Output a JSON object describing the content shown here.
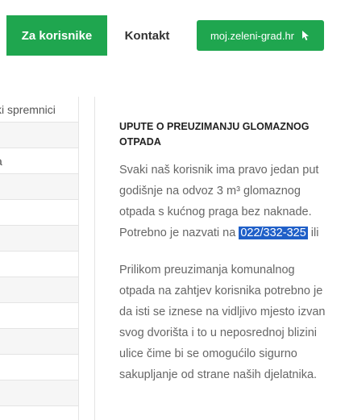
{
  "nav": {
    "active_label": "Za korisnike",
    "contact_label": "Kontakt",
    "portal_label": "moj.zeleni-grad.hr",
    "portal_icon": "cursor-arrow-icon"
  },
  "sidebar": {
    "rows": [
      "ki spremnici",
      "",
      "a",
      "",
      "",
      "",
      "",
      "",
      "",
      "",
      "",
      "",
      ""
    ]
  },
  "article": {
    "title": "UPUTE O PREUZIMANJU GLOMAZNOG OTPADA",
    "para1_text": "Svaki naš korisnik ima pravo jedan put godišnje na odvoz 3 m³ glomaznog otpada s kućnog praga bez naknade. Potrebno je nazvati na ",
    "phone": "022/332-325",
    "para1_tail": " ili",
    "para2": "Prilikom preuzimanja komunalnog otpada na zahtjev korisnika potrebno je da isti se iznese na vidljivo mjesto izvan svog dvorišta i to u neposrednoj blizini ulice čime bi se omogućilo sigurno sakupljanje od strane naših djelatnika."
  },
  "colors": {
    "brand_green": "#1fa64f",
    "highlight_blue": "#1f5fc8"
  }
}
